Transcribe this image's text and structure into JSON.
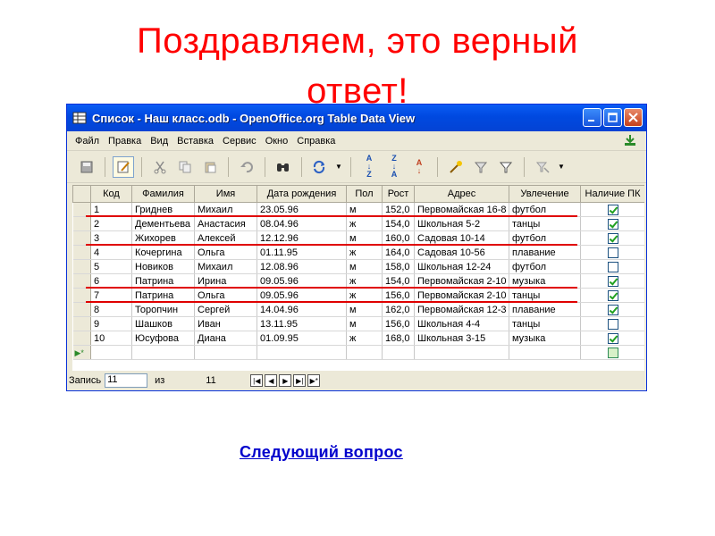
{
  "heading": {
    "line1": "Поздравляем, это верный",
    "line2": "ответ!"
  },
  "window": {
    "title": "Список - Наш класс.odb - OpenOffice.org Table Data View",
    "menu": [
      "Файл",
      "Правка",
      "Вид",
      "Вставка",
      "Сервис",
      "Окно",
      "Справка"
    ]
  },
  "toolbar": {
    "icons": [
      "save-icon",
      "edit-icon",
      "cut-icon",
      "copy-icon",
      "paste-icon",
      "undo-icon",
      "find-icon",
      "refresh-icon",
      "sort-ascending-icon",
      "sort-descending-icon",
      "sort-icon",
      "autofilter-icon",
      "standard-filter-icon",
      "filter-icon",
      "remove-filter-icon"
    ],
    "sort_asc": "A↓Z",
    "sort_desc": "Z↓A"
  },
  "table": {
    "columns": [
      "Код",
      "Фамилия",
      "Имя",
      "Дата рождения",
      "Пол",
      "Рост",
      "Адрес",
      "Увлечение",
      "Наличие ПК"
    ],
    "rows": [
      {
        "kod": "1",
        "familiya": "Гриднев",
        "imya": "Михаил",
        "date": "23.05.96",
        "pol": "м",
        "rost": "152,0",
        "adres": "Первомайская 16-8",
        "hobby": "футбол",
        "pc": true
      },
      {
        "kod": "2",
        "familiya": "Дементьева",
        "imya": "Анастасия",
        "date": "08.04.96",
        "pol": "ж",
        "rost": "154,0",
        "adres": "Школьная 5-2",
        "hobby": "танцы",
        "pc": true
      },
      {
        "kod": "3",
        "familiya": "Жихорев",
        "imya": "Алексей",
        "date": "12.12.96",
        "pol": "м",
        "rost": "160,0",
        "adres": "Садовая 10-14",
        "hobby": "футбол",
        "pc": true
      },
      {
        "kod": "4",
        "familiya": "Кочергина",
        "imya": "Ольга",
        "date": "01.11.95",
        "pol": "ж",
        "rost": "164,0",
        "adres": "Садовая 10-56",
        "hobby": "плавание",
        "pc": false
      },
      {
        "kod": "5",
        "familiya": "Новиков",
        "imya": "Михаил",
        "date": "12.08.96",
        "pol": "м",
        "rost": "158,0",
        "adres": "Школьная 12-24",
        "hobby": "футбол",
        "pc": false
      },
      {
        "kod": "6",
        "familiya": "Патрина",
        "imya": "Ирина",
        "date": "09.05.96",
        "pol": "ж",
        "rost": "154,0",
        "adres": "Первомайская 2-10",
        "hobby": "музыка",
        "pc": true
      },
      {
        "kod": "7",
        "familiya": "Патрина",
        "imya": "Ольга",
        "date": "09.05.96",
        "pol": "ж",
        "rost": "156,0",
        "adres": "Первомайская 2-10",
        "hobby": "танцы",
        "pc": true
      },
      {
        "kod": "8",
        "familiya": "Торопчин",
        "imya": "Сергей",
        "date": "14.04.96",
        "pol": "м",
        "rost": "162,0",
        "adres": "Первомайская 12-3",
        "hobby": "плавание",
        "pc": true
      },
      {
        "kod": "9",
        "familiya": "Шашков",
        "imya": "Иван",
        "date": "13.11.95",
        "pol": "м",
        "rost": "156,0",
        "adres": "Школьная 4-4",
        "hobby": "танцы",
        "pc": false
      },
      {
        "kod": "10",
        "familiya": "Юсуфова",
        "imya": "Диана",
        "date": "01.09.95",
        "pol": "ж",
        "rost": "168,0",
        "adres": "Школьная 3-15",
        "hobby": "музыка",
        "pc": true
      }
    ]
  },
  "status": {
    "record_label": "Запись",
    "record_value": "11",
    "of_label": "из",
    "total": "11"
  },
  "highlight": {
    "color": "#e00000",
    "rows": [
      1,
      3,
      6,
      7
    ]
  },
  "next_link": "Следующий вопрос"
}
